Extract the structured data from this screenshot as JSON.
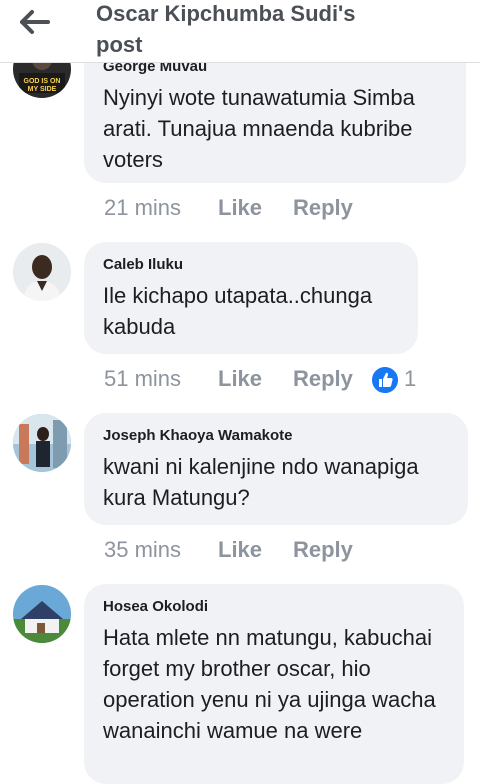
{
  "header": {
    "title_line1": "Oscar Kipchumba Sudi's",
    "title_line2": "post"
  },
  "comments": [
    {
      "author": "George Muvau",
      "text": "Nyinyi wote tunawatumia Simba arati. Tunajua mnaenda kubribe voters",
      "time": "21 mins",
      "like": "Like",
      "reply": "Reply",
      "avatar_label": "GOD IS ON MY SIDE"
    },
    {
      "author": "Caleb Iluku",
      "text": "Ile kichapo utapata..chunga kabuda",
      "time": "51 mins",
      "like": "Like",
      "reply": "Reply",
      "reaction": "like-icon",
      "reaction_count": "1"
    },
    {
      "author": "Joseph Khaoya Wamakote",
      "text": "kwani ni kalenjine ndo wanapiga kura Matungu?",
      "time": "35 mins",
      "like": "Like",
      "reply": "Reply"
    },
    {
      "author": "Hosea Okolodi",
      "text": "Hata mlete nn matungu, kabuchai forget my brother oscar, hio operation yenu ni ya ujinga wacha wanainchi wamue na were"
    }
  ],
  "colors": {
    "bubble": "#f0f2f5",
    "meta": "#8d949e",
    "like_blue": "#1877f2"
  }
}
